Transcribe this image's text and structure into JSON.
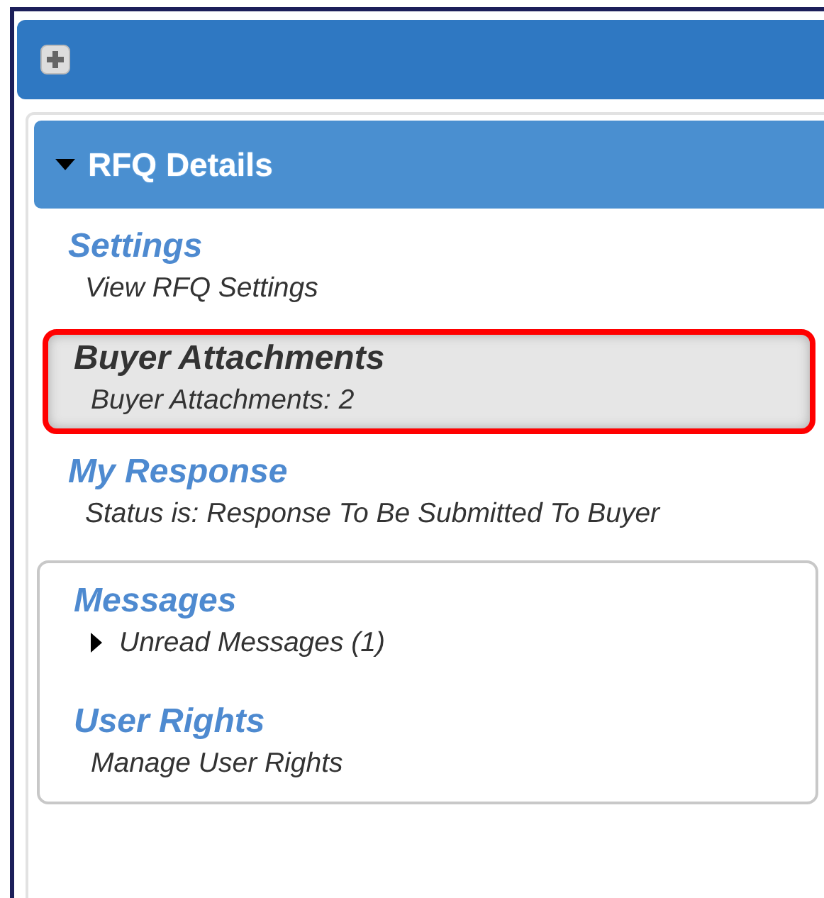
{
  "section": {
    "title": "RFQ Details",
    "expanded": true,
    "items": [
      {
        "title": "Settings",
        "subtitle": "View RFQ Settings",
        "selected": false
      },
      {
        "title": "Buyer Attachments",
        "subtitle": "Buyer Attachments: 2",
        "selected": true
      },
      {
        "title": "My Response",
        "subtitle": "Status is: Response To Be Submitted To Buyer",
        "selected": false
      }
    ]
  },
  "panel": {
    "items": [
      {
        "title": "Messages",
        "subtitle": "Unread Messages (1)",
        "expanded": false
      },
      {
        "title": "User Rights",
        "subtitle": "Manage User Rights"
      }
    ]
  }
}
